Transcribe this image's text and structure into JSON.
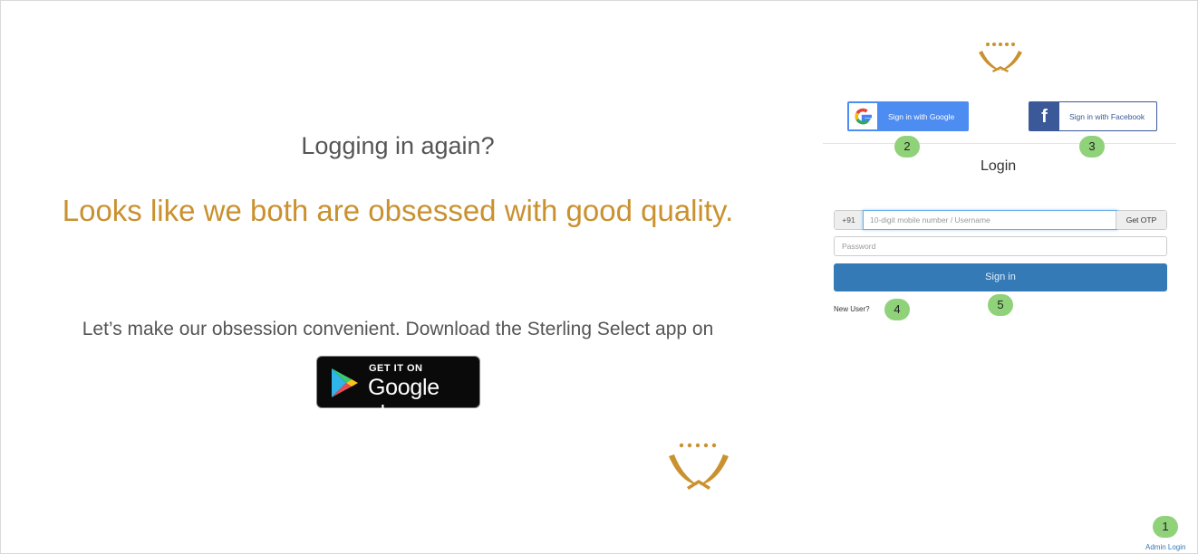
{
  "left": {
    "question": "Logging in again?",
    "tagline": "Looks like we both are obsessed with good quality.",
    "download_text": "Let’s make our obsession convenient. Download the Sterling Select app on",
    "google_play": {
      "top": "GET IT ON",
      "big": "Google play"
    }
  },
  "login": {
    "google_label": "Sign in with Google",
    "facebook_label": "Sign in with Facebook",
    "title": "Login",
    "country_code": "+91",
    "mobile_placeholder": "10-digit mobile number / Username",
    "otp_label": "Get OTP",
    "password_placeholder": "Password",
    "signin_label": "Sign in",
    "new_user": "New User?",
    "admin_login": "Admin Login"
  },
  "badges": [
    "1",
    "2",
    "3",
    "4",
    "5"
  ],
  "colors": {
    "gold": "#c9912f",
    "primary": "#337ab7",
    "google": "#4d8cf0",
    "facebook": "#3b5998",
    "badge": "#8fd27a"
  },
  "icons": [
    "google-g-icon",
    "facebook-f-icon",
    "google-play-icon",
    "laurel-logo-icon"
  ]
}
